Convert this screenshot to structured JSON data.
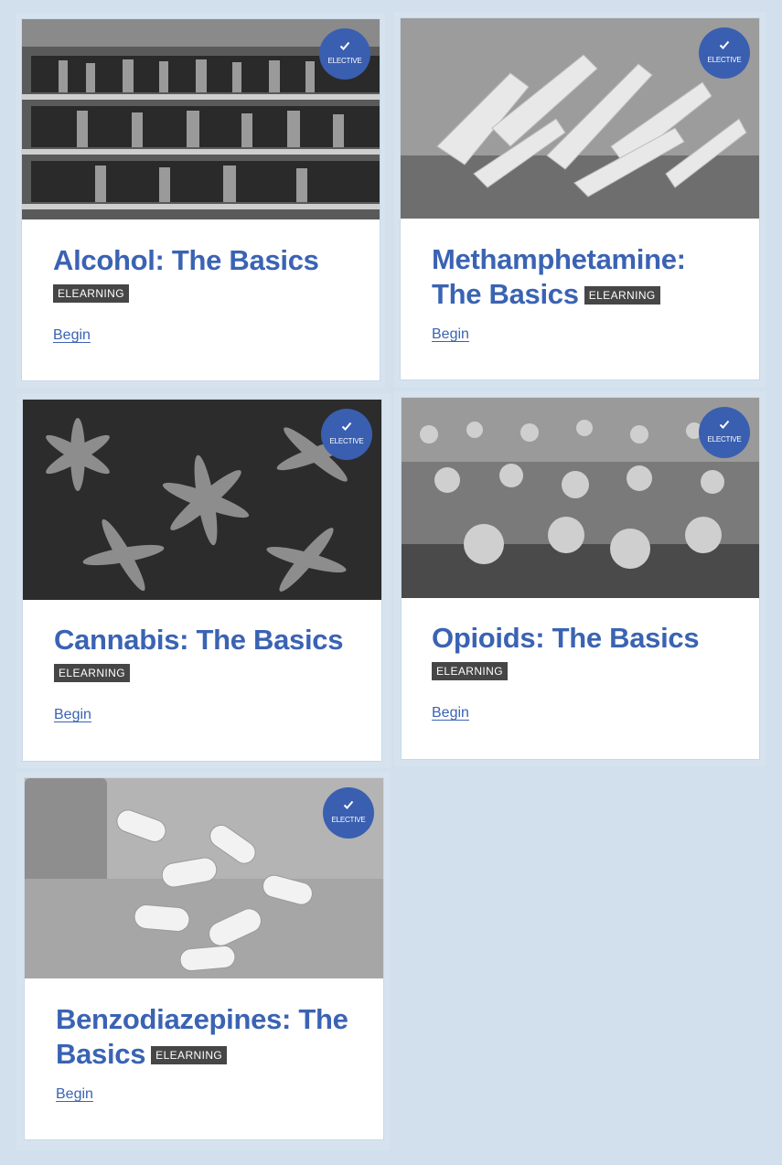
{
  "badge_label": "ELECTIVE",
  "colors": {
    "page_background": "#d1e0ec",
    "title": "#3a63b3",
    "badge": "#3a5fb0",
    "tag_background": "#464646"
  },
  "courses": [
    {
      "title": "Alcohol: The Basics",
      "tag": "ELEARNING",
      "link": "Begin",
      "image_icon": "liquor-shelves-photo"
    },
    {
      "title": "Methamphetamine: The Basics",
      "tag": "ELEARNING",
      "link": "Begin",
      "image_icon": "crystals-photo"
    },
    {
      "title": "Cannabis: The Basics",
      "tag": "ELEARNING",
      "link": "Begin",
      "image_icon": "cannabis-leaves-photo"
    },
    {
      "title": "Opioids: The Basics",
      "tag": "ELEARNING",
      "link": "Begin",
      "image_icon": "poppy-field-photo"
    },
    {
      "title": "Benzodiazepines: The Basics",
      "tag": "ELEARNING",
      "link": "Begin",
      "image_icon": "pills-photo"
    }
  ]
}
